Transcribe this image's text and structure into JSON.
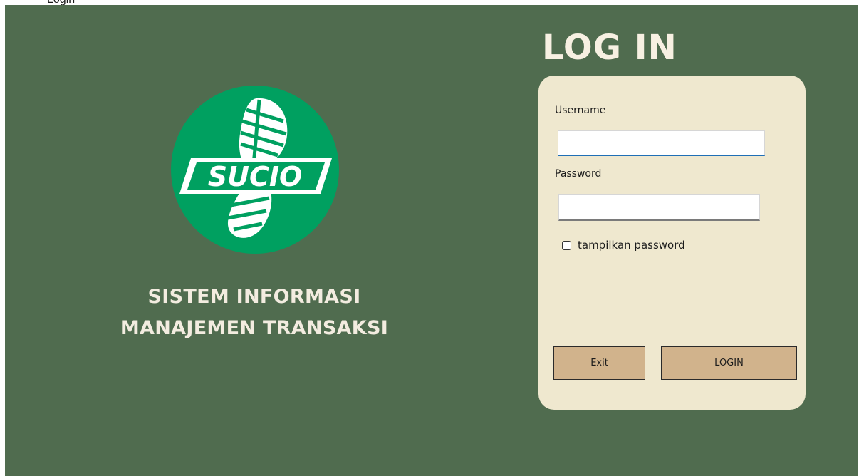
{
  "window": {
    "partial_title": "Login"
  },
  "brand": {
    "logo_text": "SUCIO",
    "line1": "SISTEM INFORMASI",
    "line2": "MANAJEMEN TRANSAKSI"
  },
  "login": {
    "title": "LOG IN",
    "username_label": "Username",
    "username_value": "",
    "password_label": "Password",
    "password_value": "",
    "show_password_label": "tampilkan password",
    "show_password_checked": false,
    "exit_label": "Exit",
    "login_label": "LOGIN"
  },
  "colors": {
    "background": "#506c4f",
    "panel": "#efe8cf",
    "button": "#d1b38c",
    "logo_green": "#00a060",
    "title_text": "#f7f0e2"
  }
}
